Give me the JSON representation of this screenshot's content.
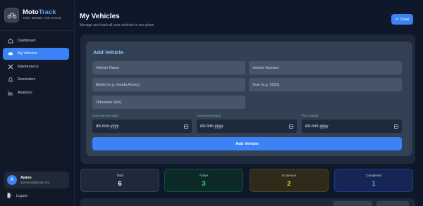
{
  "brand": {
    "name_main": "Moto",
    "name_accent": "Track",
    "tagline": "Track. Maintain. Ride Smooth."
  },
  "sidebar": {
    "items": [
      {
        "label": "Dashboard",
        "icon": "home-icon"
      },
      {
        "label": "My Vehicles",
        "icon": "car-icon",
        "active": true
      },
      {
        "label": "Maintenance",
        "icon": "wrench-icon"
      },
      {
        "label": "Reminders",
        "icon": "bell-icon"
      },
      {
        "label": "Analytics",
        "icon": "chart-icon"
      }
    ],
    "user": {
      "initial": "A",
      "name": "Ayano",
      "email": "ayanokoji@gmail.com"
    },
    "logout": "Logout"
  },
  "header": {
    "title": "My Vehicles",
    "subtitle": "Manage and track all your vehicles in one place",
    "close_label": "Close"
  },
  "form": {
    "title": "Add Vehicle",
    "vehicle_name_placeholder": "Vehicle Name",
    "vehicle_number_placeholder": "Vehicle Number",
    "model_placeholder": "Model (e.g. Honda Activa)",
    "year_placeholder": "Year (e.g. 2021)",
    "odometer_placeholder": "Odometer (km)",
    "next_service_label": "Next Service Date",
    "insurance_label": "Insurance Expiry",
    "puc_label": "PUC Expiry",
    "date_placeholder": "dd-mm-yyyy",
    "submit_label": "Add Vehicle"
  },
  "stats": [
    {
      "label": "Total",
      "value": "6"
    },
    {
      "label": "Active",
      "value": "3"
    },
    {
      "label": "In Service",
      "value": "2"
    },
    {
      "label": "Completed",
      "value": "1"
    }
  ],
  "colors": {
    "accent": "#3b82f6",
    "active_green": "#4ade80",
    "service_yellow": "#facc15",
    "completed_blue": "#60a5fa"
  }
}
